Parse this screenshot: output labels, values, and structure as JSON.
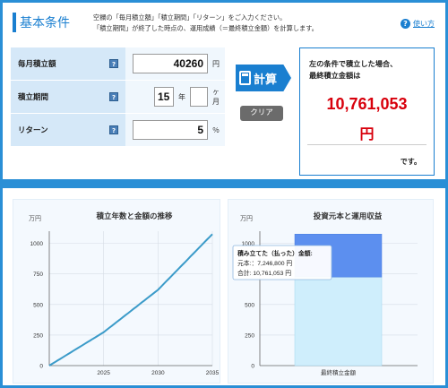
{
  "header": {
    "title": "基本条件",
    "desc_line1": "空欄の「毎月積立額」「積立期間」「リターン」をご入力ください。",
    "desc_line2": "「積立期間」が終了した時点の、運用成績（＝最終積立金額）を計算します。",
    "help_label": "使い方"
  },
  "form": {
    "monthly_label": "毎月積立額",
    "monthly_value": "40260",
    "monthly_unit": "円",
    "period_label": "積立期間",
    "years_value": "15",
    "years_unit": "年",
    "months_value": "",
    "months_unit": "ヶ月",
    "return_label": "リターン",
    "return_value": "5",
    "return_unit": "％"
  },
  "buttons": {
    "calc": "計算",
    "clear": "クリア"
  },
  "result": {
    "label_line1": "左の条件で積立した場合、",
    "label_line2": "最終積立金額は",
    "amount": "10,761,053",
    "unit": "円",
    "suffix": "です。"
  },
  "chart_data": [
    {
      "type": "line",
      "title": "積立年数と金額の推移",
      "ylabel": "万円",
      "x": [
        2020,
        2025,
        2030,
        2035
      ],
      "xticks": [
        "2025",
        "2030",
        "2035"
      ],
      "series": [
        {
          "values": [
            0,
            273,
            620,
            1076
          ]
        }
      ],
      "ylim": [
        0,
        1100
      ],
      "yticks": [
        0,
        250,
        500,
        750,
        1000
      ],
      "color": "#3b9bc9"
    },
    {
      "type": "bar",
      "title": "投資元本と運用収益",
      "ylabel": "万円",
      "categories": [
        "最終積立金額"
      ],
      "series": [
        {
          "values": [
            724.68
          ],
          "color": "#cfeefc"
        },
        {
          "values": [
            351.42
          ],
          "color": "#5c8fef"
        }
      ],
      "ylim": [
        0,
        1100
      ],
      "yticks": [
        0,
        250,
        500,
        750,
        1000
      ],
      "tooltip": {
        "title": "積み立てた（払った）金額:",
        "line1": "元本:：7,246,800 円",
        "line2": "合計: 10,761,053 円"
      }
    }
  ],
  "colors": {
    "accent": "#1a7fd0",
    "result_red": "#d8000c",
    "frame_blue": "#2a8fd6"
  }
}
